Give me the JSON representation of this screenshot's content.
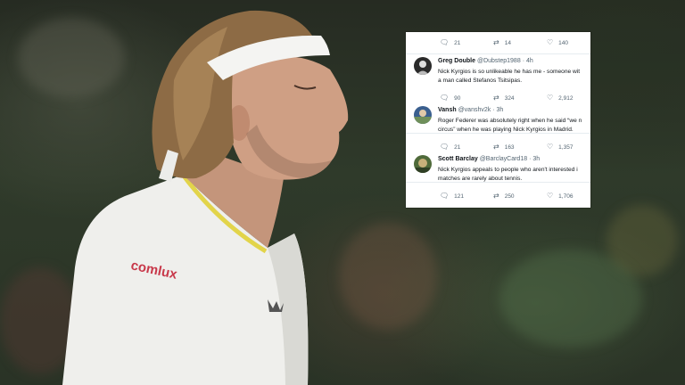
{
  "jersey_logo": "comlux",
  "tweets": [
    {
      "author": "",
      "handle": "",
      "time": "",
      "text": "",
      "replies": "21",
      "retweets": "14",
      "likes": "140"
    },
    {
      "author": "Greg Double",
      "handle": "@Dubstep1988",
      "time": "· 4h",
      "text_lines": [
        "Nick Kyrgios is so unlikeable he has me - someone wit",
        "a man called Stefanos Tsitsipas."
      ],
      "replies": "90",
      "retweets": "324",
      "likes": "2,912"
    },
    {
      "author": "Vansh",
      "handle": "@vanshv2k",
      "time": "· 3h",
      "text_lines": [
        "Roger Federer was absolutely right when he said “we n",
        "circus” when he was playing Nick Kyrgios in Madrid."
      ],
      "replies": "21",
      "retweets": "163",
      "likes": "1,357"
    },
    {
      "author": "Scott Barclay",
      "handle": "@BarclayCard18",
      "time": "· 3h",
      "text_lines": [
        "Nick Kyrgios appeals to people who aren't interested i",
        "matches are rarely about tennis."
      ],
      "replies": "121",
      "retweets": "250",
      "likes": "1,706"
    }
  ],
  "icons": {
    "reply": "reply-icon",
    "retweet": "retweet-icon",
    "like": "like-icon"
  },
  "colors": {
    "shirt": "#f2f2ef",
    "shirt_trim": "#e8d84a",
    "logo": "#c8384a",
    "headband": "#f4f4f2",
    "hair": "#8a6a45",
    "skin": "#c99a80"
  }
}
